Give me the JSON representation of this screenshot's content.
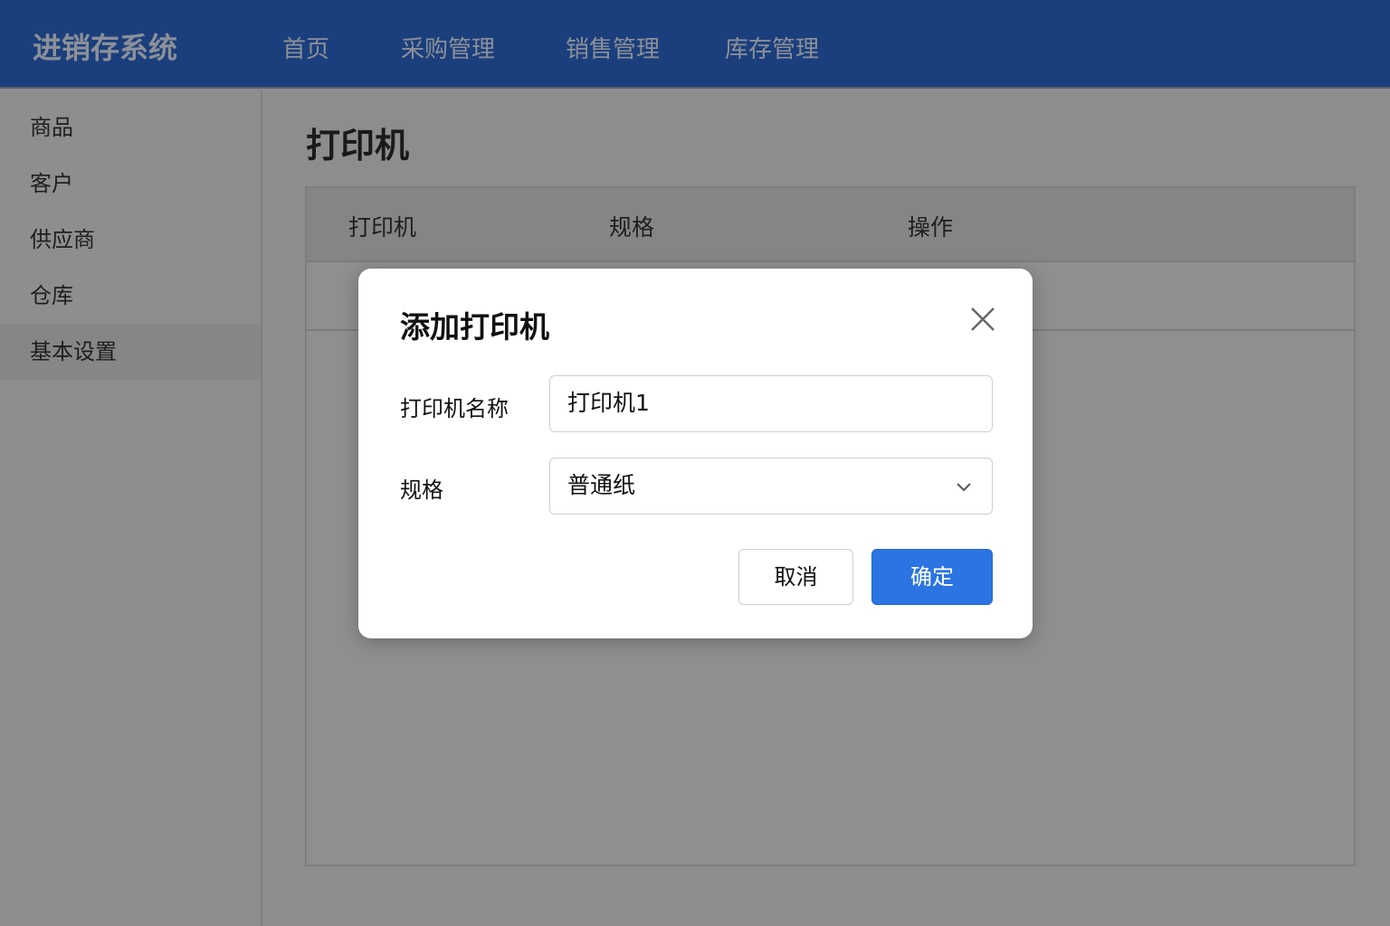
{
  "header": {
    "logo": "进销存系统",
    "nav": [
      "首页",
      "采购管理",
      "销售管理",
      "库存管理"
    ]
  },
  "sidebar": {
    "items": [
      "商品",
      "客户",
      "供应商",
      "仓库",
      "基本设置"
    ],
    "active": "基本设置"
  },
  "main": {
    "title": "打印机",
    "columns": [
      "打印机",
      "规格",
      "操作"
    ]
  },
  "modal": {
    "title": "添加打印机",
    "name_label": "打印机名称",
    "name_value": "打印机1",
    "spec_label": "规格",
    "spec_value": "普通纸",
    "cancel": "取消",
    "confirm": "确定"
  },
  "colors": {
    "header": "#1b3f7c",
    "primary": "#2b74e1"
  }
}
